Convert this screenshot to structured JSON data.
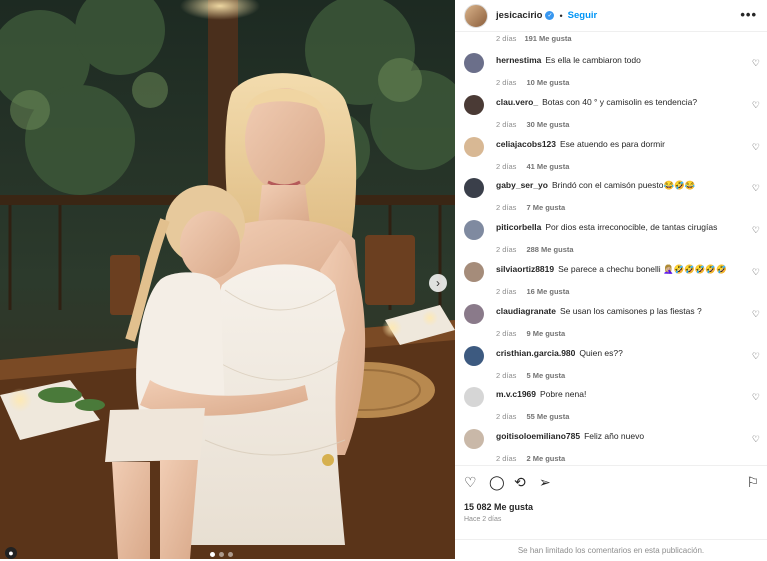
{
  "post": {
    "username": "jesicacirio",
    "follow_label": "Seguir",
    "more_label": "•••",
    "likes": "15 082 Me gusta",
    "posted": "Hace 2 días",
    "comments_limited": "Se han limitado los comentarios en esta publicación."
  },
  "top_comment_meta": {
    "time": "2 días",
    "likes": "191 Me gusta"
  },
  "comments": [
    {
      "user": "hernestima",
      "text": "Es ella le cambiaron todo",
      "time": "2 días",
      "likes": "10 Me gusta",
      "avatar_color": "#6b6f8a"
    },
    {
      "user": "clau.vero_",
      "text": "Botas con 40 ° y camisolin es tendencia?",
      "time": "2 días",
      "likes": "30 Me gusta",
      "avatar_color": "#4a3a35"
    },
    {
      "user": "celiajacobs123",
      "text": "Ese atuendo es para dormir",
      "time": "2 días",
      "likes": "41 Me gusta",
      "avatar_color": "#d8b894"
    },
    {
      "user": "gaby_ser_yo",
      "text": "Brindó con el camisón puesto😂🤣😂",
      "time": "2 días",
      "likes": "7 Me gusta",
      "avatar_color": "#3a3f4a"
    },
    {
      "user": "piticorbella",
      "text": "Por dios esta irreconocible, de tantas cirugías",
      "time": "2 días",
      "likes": "288 Me gusta",
      "avatar_color": "#7f8aa0"
    },
    {
      "user": "silviaortiz8819",
      "text": "Se parece a chechu bonelli 🤦🏼‍♀️🤣🤣🤣🤣🤣",
      "time": "2 días",
      "likes": "16 Me gusta",
      "avatar_color": "#a58c7a"
    },
    {
      "user": "claudiagranate",
      "text": "Se usan los camisones p las fiestas ?",
      "time": "2 días",
      "likes": "9 Me gusta",
      "avatar_color": "#8a7a8a"
    },
    {
      "user": "cristhian.garcia.980",
      "text": "Quien es??",
      "time": "2 días",
      "likes": "5 Me gusta",
      "avatar_color": "#3d5a80"
    },
    {
      "user": "m.v.c1969",
      "text": "Pobre nena!",
      "time": "2 días",
      "likes": "55 Me gusta",
      "avatar_color": "#d6d6d6"
    },
    {
      "user": "goitisoloemiliano785",
      "text": "Feliz año nuevo",
      "time": "2 días",
      "likes": "2 Me gusta",
      "avatar_color": "#c9b8a8"
    }
  ],
  "icons": {
    "like": "heart-icon",
    "comment": "comment-icon",
    "share": "repost-icon",
    "send": "send-icon",
    "save": "bookmark-icon",
    "next": "chevron-right-icon"
  },
  "colors": {
    "accent": "#0095f6",
    "verified": "#3897f0"
  }
}
